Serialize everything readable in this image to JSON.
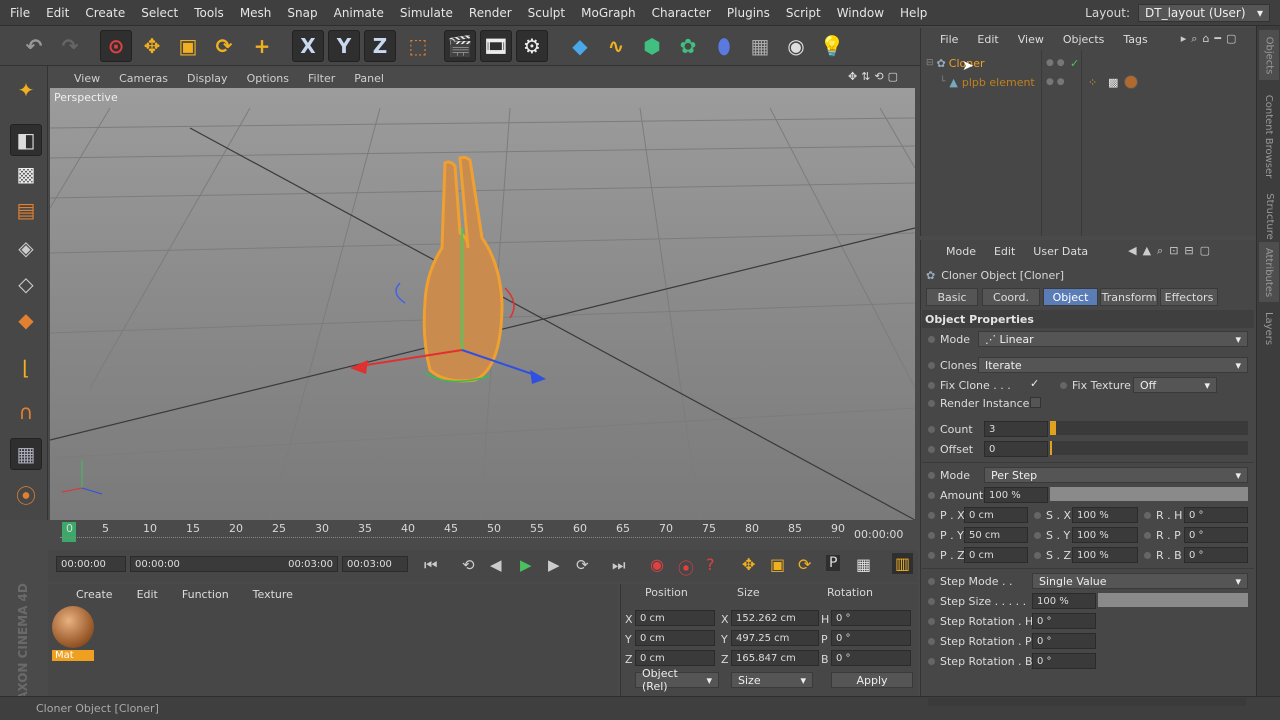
{
  "menubar": {
    "items": [
      "File",
      "Edit",
      "Create",
      "Select",
      "Tools",
      "Mesh",
      "Snap",
      "Animate",
      "Simulate",
      "Render",
      "Sculpt",
      "MoGraph",
      "Character",
      "Plugins",
      "Script",
      "Window",
      "Help"
    ],
    "layout_label": "Layout:",
    "layout_value": "DT_layout (User)"
  },
  "toolbar": {
    "x_label": "X",
    "y_label": "Y",
    "z_label": "Z"
  },
  "viewport": {
    "menu": [
      "View",
      "Cameras",
      "Display",
      "Options",
      "Filter",
      "Panel"
    ],
    "label": "Perspective"
  },
  "timeline": {
    "ticks": [
      "0",
      "5",
      "10",
      "15",
      "20",
      "25",
      "30",
      "35",
      "40",
      "45",
      "50",
      "55",
      "60",
      "65",
      "70",
      "75",
      "80",
      "85",
      "90"
    ],
    "current_time": "00:00:00"
  },
  "timectl": {
    "start": "00:00:00",
    "range_start": "00:00:00",
    "range_end": "00:03:00",
    "end": "00:03:00"
  },
  "material": {
    "menu": [
      "Create",
      "Edit",
      "Function",
      "Texture"
    ],
    "mat_name": "Mat"
  },
  "coords": {
    "headers": [
      "Position",
      "Size",
      "Rotation"
    ],
    "rows": [
      {
        "axis": "X",
        "pos": "0 cm",
        "saxis": "X",
        "size": "152.262 cm",
        "raxis": "H",
        "rot": "0 °"
      },
      {
        "axis": "Y",
        "pos": "0 cm",
        "saxis": "Y",
        "size": "497.25 cm",
        "raxis": "P",
        "rot": "0 °"
      },
      {
        "axis": "Z",
        "pos": "0 cm",
        "saxis": "Z",
        "size": "165.847 cm",
        "raxis": "B",
        "rot": "0 °"
      }
    ],
    "mode1": "Object (Rel)",
    "mode2": "Size",
    "apply": "Apply"
  },
  "status": "Cloner Object [Cloner]",
  "brand": "MAXON CINEMA 4D",
  "objects": {
    "menu": [
      "File",
      "Edit",
      "View",
      "Objects",
      "Tags"
    ],
    "items": [
      {
        "name": "Cloner"
      },
      {
        "name": "plpb element"
      }
    ]
  },
  "attributes": {
    "menu": [
      "Mode",
      "Edit",
      "User Data"
    ],
    "title": "Cloner Object [Cloner]",
    "tabs": [
      "Basic",
      "Coord.",
      "Object",
      "Transform",
      "Effectors"
    ],
    "section": "Object Properties",
    "mode_label": "Mode",
    "mode_value": "Linear",
    "clones_label": "Clones",
    "clones_value": "Iterate",
    "fix_clone_label": "Fix Clone . . .",
    "fix_texture_label": "Fix Texture",
    "fix_texture_value": "Off",
    "render_inst_label": "Render Instances",
    "count_label": "Count",
    "count_value": "3",
    "offset_label": "Offset",
    "offset_value": "0",
    "mode2_label": "Mode",
    "mode2_value": "Per Step",
    "amount_label": "Amount",
    "amount_value": "100 %",
    "p_labels": [
      "P . X",
      "P . Y",
      "P . Z"
    ],
    "p_values": [
      "0 cm",
      "50 cm",
      "0 cm"
    ],
    "s_labels": [
      "S . X",
      "S . Y",
      "S . Z"
    ],
    "s_values": [
      "100 %",
      "100 %",
      "100 %"
    ],
    "r_labels": [
      "R . H",
      "R . P",
      "R . B"
    ],
    "r_values": [
      "0 °",
      "0 °",
      "0 °"
    ],
    "step_mode_label": "Step Mode . .",
    "step_mode_value": "Single Value",
    "step_size_label": "Step Size . . . . .",
    "step_size_value": "100 %",
    "step_rot": [
      {
        "label": "Step Rotation . H",
        "value": "0 °"
      },
      {
        "label": "Step Rotation . P",
        "value": "0 °"
      },
      {
        "label": "Step Rotation . B",
        "value": "0 °"
      }
    ]
  },
  "side_tabs": [
    "Objects",
    "Content Browser",
    "Structure",
    "Attributes",
    "Layers"
  ]
}
